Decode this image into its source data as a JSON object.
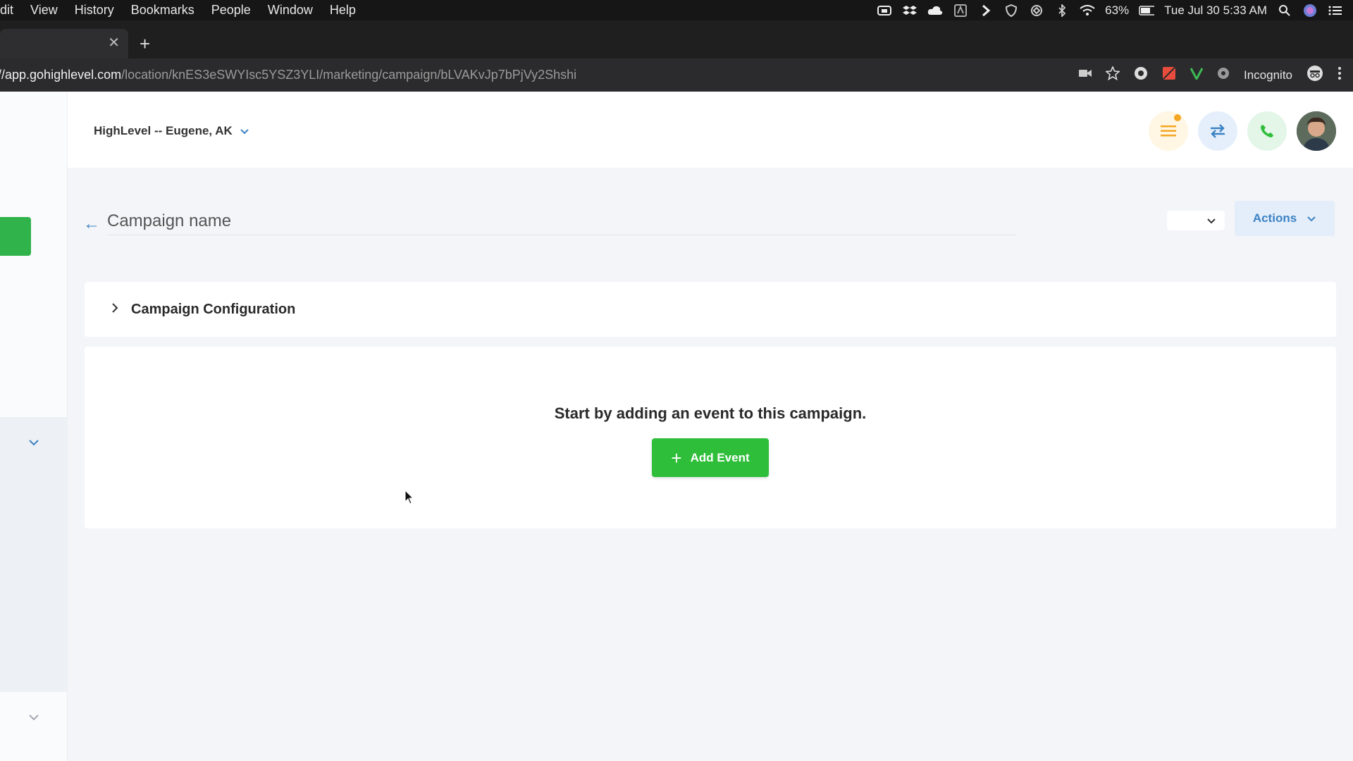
{
  "menubar": {
    "items": [
      "dit",
      "View",
      "History",
      "Bookmarks",
      "People",
      "Window",
      "Help"
    ],
    "battery": "63%",
    "datetime": "Tue Jul 30  5:33 AM"
  },
  "browser": {
    "url_host": "://app.gohighlevel.com",
    "url_path": "/location/knES3eSWYIsc5YSZ3YLI/marketing/campaign/bLVAKvJp7bPjVy2Shshi",
    "mode_label": "Incognito"
  },
  "topbar": {
    "location_name": "HighLevel -- Eugene, AK"
  },
  "campaign": {
    "name_placeholder": "Campaign name",
    "actions_label": "Actions",
    "config_title": "Campaign Configuration",
    "empty_message": "Start by adding an event to this campaign.",
    "add_event_label": "Add Event"
  },
  "colors": {
    "brand_green": "#2fbe3a",
    "accent_blue": "#3b82c4",
    "page_bg": "#f3f5f8"
  }
}
